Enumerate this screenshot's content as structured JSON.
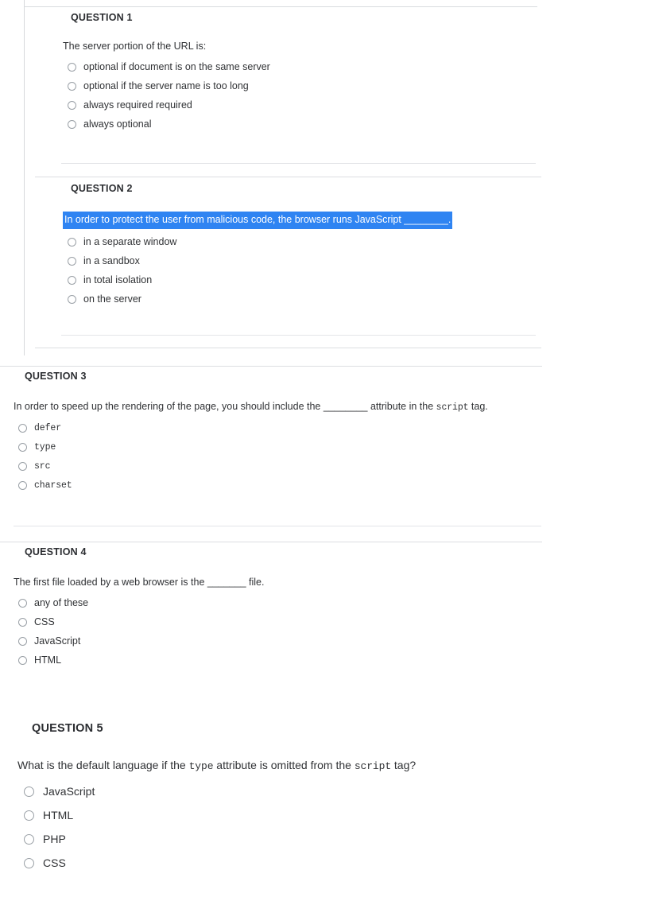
{
  "questions": [
    {
      "id": "q1",
      "title": "QUESTION 1",
      "prompt": "The server portion of the URL is:",
      "selected": false,
      "options": [
        "optional if document is on the same server",
        "optional if the server name is too long",
        "always required required",
        "always optional"
      ]
    },
    {
      "id": "q2",
      "title": "QUESTION 2",
      "prompt": "In order to protect the user from malicious code, the browser runs JavaScript ________.",
      "selected": true,
      "options": [
        "in a separate window",
        "in a sandbox",
        "in total isolation",
        "on the server"
      ]
    },
    {
      "id": "q3",
      "title": "QUESTION 3",
      "prompt_parts": {
        "a": "In order to speed up the rendering of the page, you should include the ________ attribute in the ",
        "b": "script",
        "c": " tag."
      },
      "selected": false,
      "options": [
        "defer",
        "type",
        "src",
        "charset"
      ],
      "options_mono": true
    },
    {
      "id": "q4",
      "title": "QUESTION 4",
      "prompt": "The first file loaded by a web browser is the _______ file.",
      "selected": false,
      "options": [
        "any of these",
        "CSS",
        "JavaScript",
        "HTML"
      ]
    },
    {
      "id": "q5",
      "title": "QUESTION 5",
      "prompt_parts": {
        "a": "What is the default language if the ",
        "b": "type",
        "c": " attribute is omitted from the ",
        "d": "script",
        "e": " tag?"
      },
      "selected": false,
      "options": [
        "JavaScript",
        "HTML",
        "PHP",
        "CSS"
      ]
    }
  ],
  "colors": {
    "selection_blue": "#2f84f2",
    "selection_text": "#ffffff",
    "body_text": "#303235",
    "rule": "#e3e5e8",
    "radio_border": "#9aa0a6"
  }
}
